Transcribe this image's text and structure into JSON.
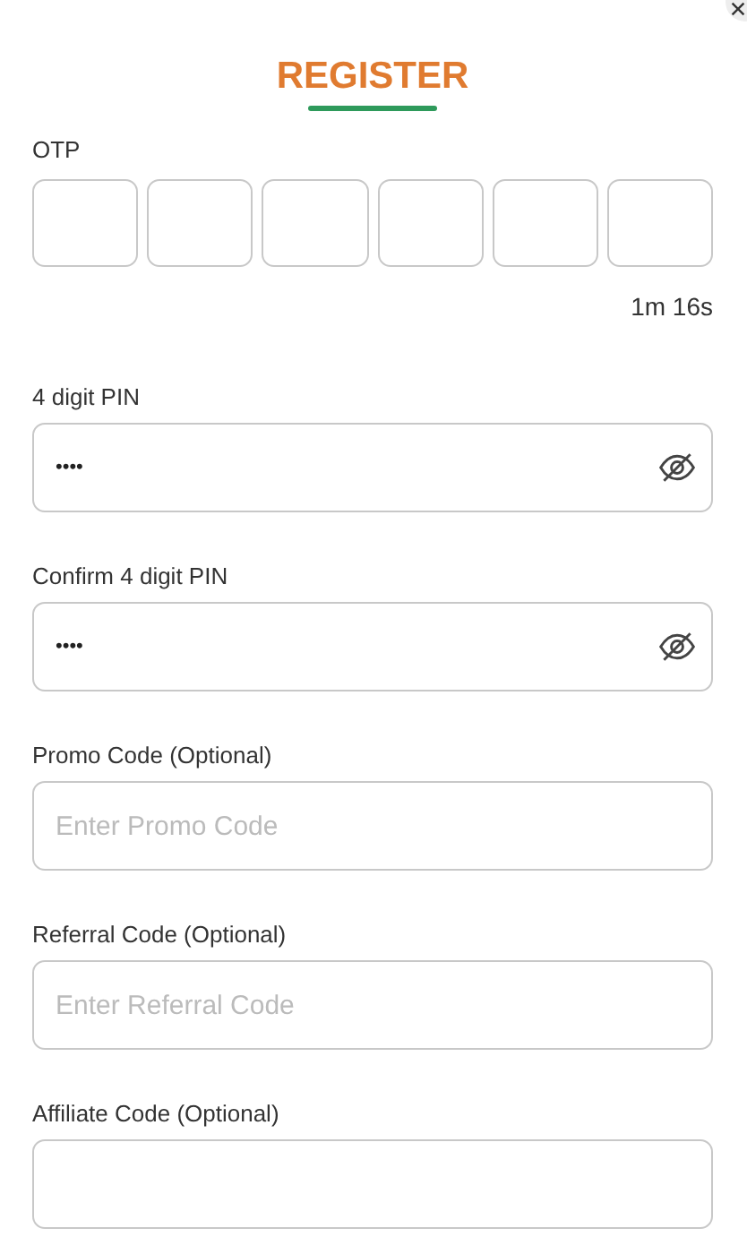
{
  "title": "REGISTER",
  "otp": {
    "label": "OTP",
    "timer": "1m 16s"
  },
  "fields": [
    {
      "kind": "password",
      "label": "4 digit PIN",
      "value": "••••"
    },
    {
      "kind": "password",
      "label": "Confirm 4 digit PIN",
      "value": "••••"
    },
    {
      "kind": "text",
      "label": "Promo Code (Optional)",
      "placeholder": "Enter Promo Code"
    },
    {
      "kind": "text",
      "label": "Referral Code (Optional)",
      "placeholder": "Enter Referral Code"
    },
    {
      "kind": "text",
      "label": "Affiliate Code (Optional)"
    }
  ]
}
